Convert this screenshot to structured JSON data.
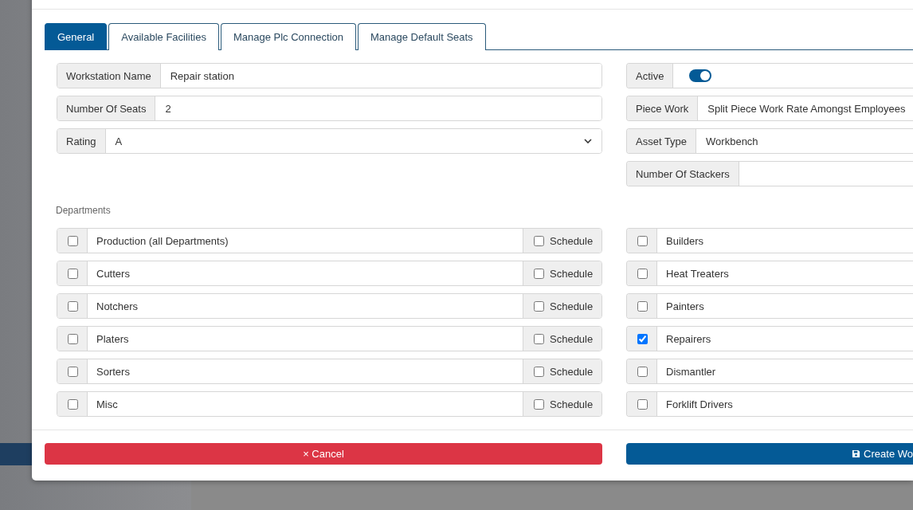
{
  "tabs": [
    {
      "label": "General",
      "selected": true
    },
    {
      "label": "Available Facilities",
      "selected": false
    },
    {
      "label": "Manage Plc Connection",
      "selected": false
    },
    {
      "label": "Manage Default Seats",
      "selected": false
    }
  ],
  "fields_left": [
    {
      "kind": "text",
      "label": "Workstation Name",
      "value": "Repair station"
    },
    {
      "kind": "text",
      "label": "Number Of Seats",
      "value": "2"
    },
    {
      "kind": "select",
      "label": "Rating",
      "value": "A"
    }
  ],
  "fields_right": [
    {
      "kind": "toggle",
      "label": "Active",
      "on": true
    },
    {
      "kind": "text",
      "label": "Piece Work",
      "value": "Split Piece Work Rate Amongst Employees"
    },
    {
      "kind": "text",
      "label": "Asset Type",
      "value": "Workbench"
    },
    {
      "kind": "text",
      "label": "Number Of Stackers"
    }
  ],
  "departments_label": "Departments",
  "departments_left": [
    {
      "name": "Production (all Departments)",
      "checked": false,
      "schedule": {
        "label": "Schedule",
        "checked": false
      }
    },
    {
      "name": "Cutters",
      "checked": false,
      "schedule": {
        "label": "Schedule",
        "checked": false
      }
    },
    {
      "name": "Notchers",
      "checked": false,
      "schedule": {
        "label": "Schedule",
        "checked": false
      }
    },
    {
      "name": "Platers",
      "checked": false,
      "schedule": {
        "label": "Schedule",
        "checked": false
      }
    },
    {
      "name": "Sorters",
      "checked": false,
      "schedule": {
        "label": "Schedule",
        "checked": false
      }
    },
    {
      "name": "Misc",
      "checked": false,
      "schedule": {
        "label": "Schedule",
        "checked": false
      }
    }
  ],
  "departments_right": [
    {
      "name": "Builders",
      "checked": false
    },
    {
      "name": "Heat Treaters",
      "checked": false
    },
    {
      "name": "Painters",
      "checked": false
    },
    {
      "name": "Repairers",
      "checked": true
    },
    {
      "name": "Dismantler",
      "checked": false
    },
    {
      "name": "Forklift Drivers",
      "checked": false
    }
  ],
  "buttons": [
    {
      "kind": "cancel",
      "icon": "×",
      "label": "Cancel"
    },
    {
      "kind": "create",
      "label": "Create Wo"
    }
  ]
}
